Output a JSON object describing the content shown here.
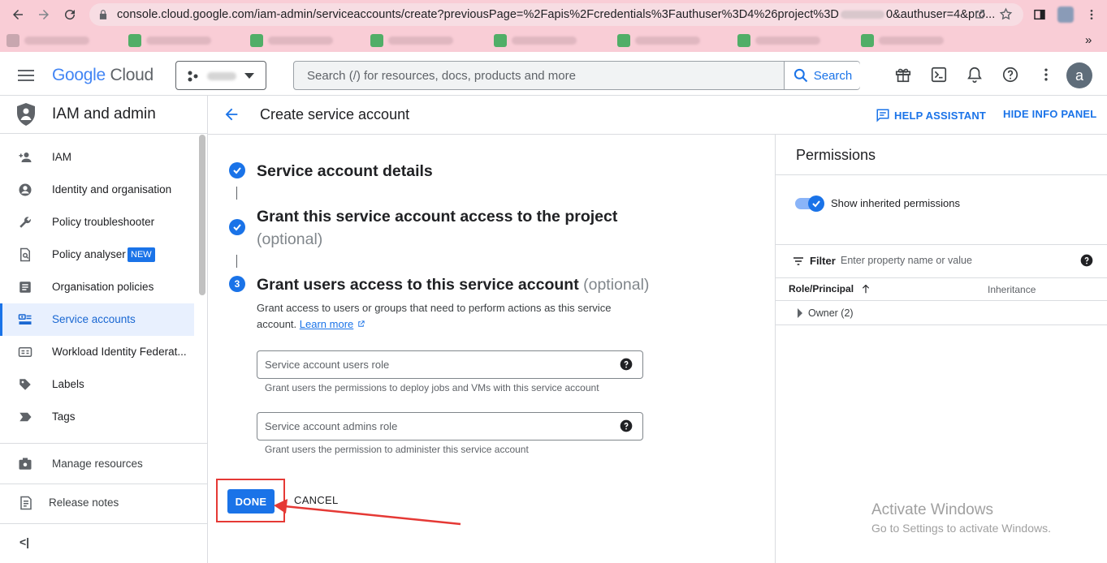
{
  "browser": {
    "url": "console.cloud.google.com/iam-admin/serviceaccounts/create?previousPage=%2Fapis%2Fcredentials%3Fauthuser%3D4%26project%3D",
    "url_tail": "0&authuser=4&pro..."
  },
  "gcp_bar": {
    "logo_google": "Google",
    "logo_cloud": "Cloud",
    "search_placeholder": "Search (/) for resources, docs, products and more",
    "search_button": "Search",
    "avatar_letter": "a"
  },
  "sidebar": {
    "title": "IAM and admin",
    "items": [
      {
        "label": "IAM",
        "icon": "person-add-icon"
      },
      {
        "label": "Identity and organisation",
        "icon": "account-circle-icon"
      },
      {
        "label": "Policy troubleshooter",
        "icon": "wrench-icon"
      },
      {
        "label": "Policy analyser",
        "icon": "policy-doc-icon",
        "badge": "NEW"
      },
      {
        "label": "Organisation policies",
        "icon": "list-box-icon"
      },
      {
        "label": "Service accounts",
        "icon": "service-account-icon",
        "active": true
      },
      {
        "label": "Workload Identity Federat...",
        "icon": "id-card-icon"
      },
      {
        "label": "Labels",
        "icon": "label-icon"
      },
      {
        "label": "Tags",
        "icon": "tag-icon"
      }
    ],
    "manage_resources": "Manage resources",
    "release_notes": "Release notes",
    "collapse_glyph": "<|"
  },
  "header": {
    "title": "Create service account",
    "help_assistant": "HELP ASSISTANT",
    "hide_info_panel": "HIDE INFO PANEL"
  },
  "stepper": {
    "step1_title": "Service account details",
    "step2_title": "Grant this service account access to the project",
    "step2_optional": "(optional)",
    "step3_number": "3",
    "step3_title": "Grant users access to this service account",
    "step3_optional": "(optional)",
    "step3_desc": "Grant access to users or groups that need to perform actions as this service account.",
    "learn_more": "Learn more",
    "users_role_placeholder": "Service account users role",
    "users_role_hint": "Grant users the permissions to deploy jobs and VMs with this service account",
    "admins_role_placeholder": "Service account admins role",
    "admins_role_hint": "Grant users the permission to administer this service account",
    "done": "DONE",
    "cancel": "CANCEL"
  },
  "info_panel": {
    "title": "Permissions",
    "show_inherited": "Show inherited permissions",
    "show_inherited_on": true,
    "filter_label": "Filter",
    "filter_placeholder": "Enter property name or value",
    "col_role": "Role/Principal",
    "col_inheritance": "Inheritance",
    "rows": [
      {
        "label": "Owner (2)"
      }
    ]
  },
  "watermark": {
    "title": "Activate Windows",
    "subtitle": "Go to Settings to activate Windows."
  },
  "colors": {
    "accent": "#1a73e8",
    "annotation": "#e53935",
    "browser_chrome": "#f9cdd6"
  }
}
